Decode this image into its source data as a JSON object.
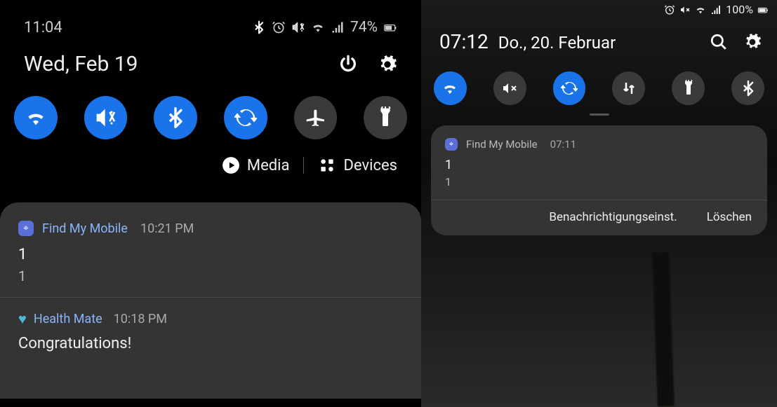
{
  "left": {
    "status": {
      "time": "11:04",
      "battery": "74%"
    },
    "date": "Wed, Feb 19",
    "qs": [
      {
        "icon": "wifi",
        "state": "on"
      },
      {
        "icon": "mute-vibrate",
        "state": "on"
      },
      {
        "icon": "bluetooth",
        "state": "on"
      },
      {
        "icon": "sync",
        "state": "on"
      },
      {
        "icon": "airplane",
        "state": "off"
      },
      {
        "icon": "flashlight",
        "state": "off"
      }
    ],
    "media_label": "Media",
    "devices_label": "Devices",
    "notifications": [
      {
        "icon": "fmm",
        "app": "Find My Mobile",
        "time": "10:21 PM",
        "title": "1",
        "body": "1"
      },
      {
        "icon": "health",
        "app": "Health Mate",
        "time": "10:18 PM",
        "title": "Congratulations!"
      }
    ]
  },
  "right": {
    "status": {
      "battery": "100%"
    },
    "time": "07:12",
    "date": "Do., 20. Februar",
    "qs": [
      {
        "icon": "wifi",
        "state": "on"
      },
      {
        "icon": "mute",
        "state": "off"
      },
      {
        "icon": "sync",
        "state": "on"
      },
      {
        "icon": "data",
        "state": "off"
      },
      {
        "icon": "flashlight",
        "state": "off"
      },
      {
        "icon": "bluetooth",
        "state": "off"
      }
    ],
    "notification": {
      "app": "Find My Mobile",
      "time": "07:11",
      "title": "1",
      "body": "1",
      "actions": {
        "settings": "Benachrichtigungseinst.",
        "clear": "Löschen"
      }
    }
  }
}
